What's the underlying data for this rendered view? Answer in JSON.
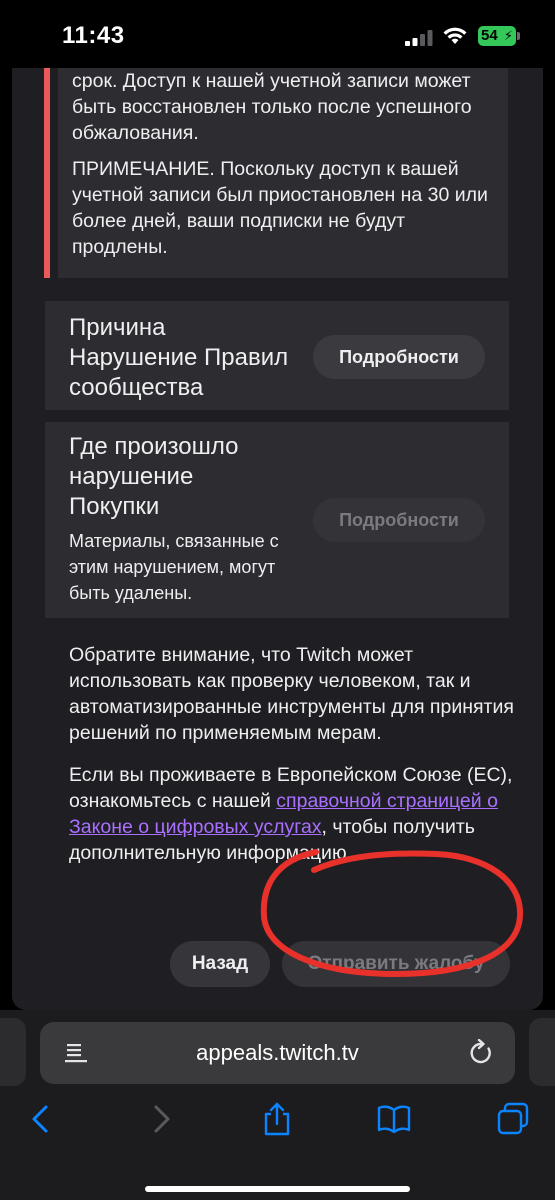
{
  "status_bar": {
    "time": "11:43",
    "battery": "54"
  },
  "notice": {
    "paragraph_1": "срок. Доступ к нашей учетной записи может быть восстановлен только после успешного обжалования.",
    "paragraph_2": "ПРИМЕЧАНИЕ. Поскольку доступ к вашей учетной записи был приостановлен на 30 или более дней, ваши подписки не будут продлены."
  },
  "reason_card": {
    "title": "Причина",
    "value": "Нарушение Правил сообщества",
    "details_button": "Подробности"
  },
  "where_card": {
    "title": "Где произошло нарушение",
    "value": "Покупки",
    "note": "Материалы, связанные с этим нарушением, могут быть удалены.",
    "details_button": "Подробности"
  },
  "info": {
    "paragraph_1": "Обратите внимание, что Twitch может использовать как проверку человеком, так и автоматизированные инструменты для принятия решений по применяемым мерам.",
    "paragraph_2_prefix": "Если вы проживаете в Европейском Союзе (ЕС), ознакомьтесь с нашей ",
    "paragraph_2_link": "справочной страницей о Законе о цифровых услугах",
    "paragraph_2_suffix": ", чтобы получить дополнительную информацию."
  },
  "actions": {
    "back_label": "Назад",
    "submit_label": "Отправить жалобу"
  },
  "browser": {
    "url": "appeals.twitch.tv"
  },
  "colors": {
    "accent_link": "#a970ff",
    "warning_bar": "#eb5a5a",
    "annotation_circle": "#e8312a",
    "battery": "#34c759"
  }
}
